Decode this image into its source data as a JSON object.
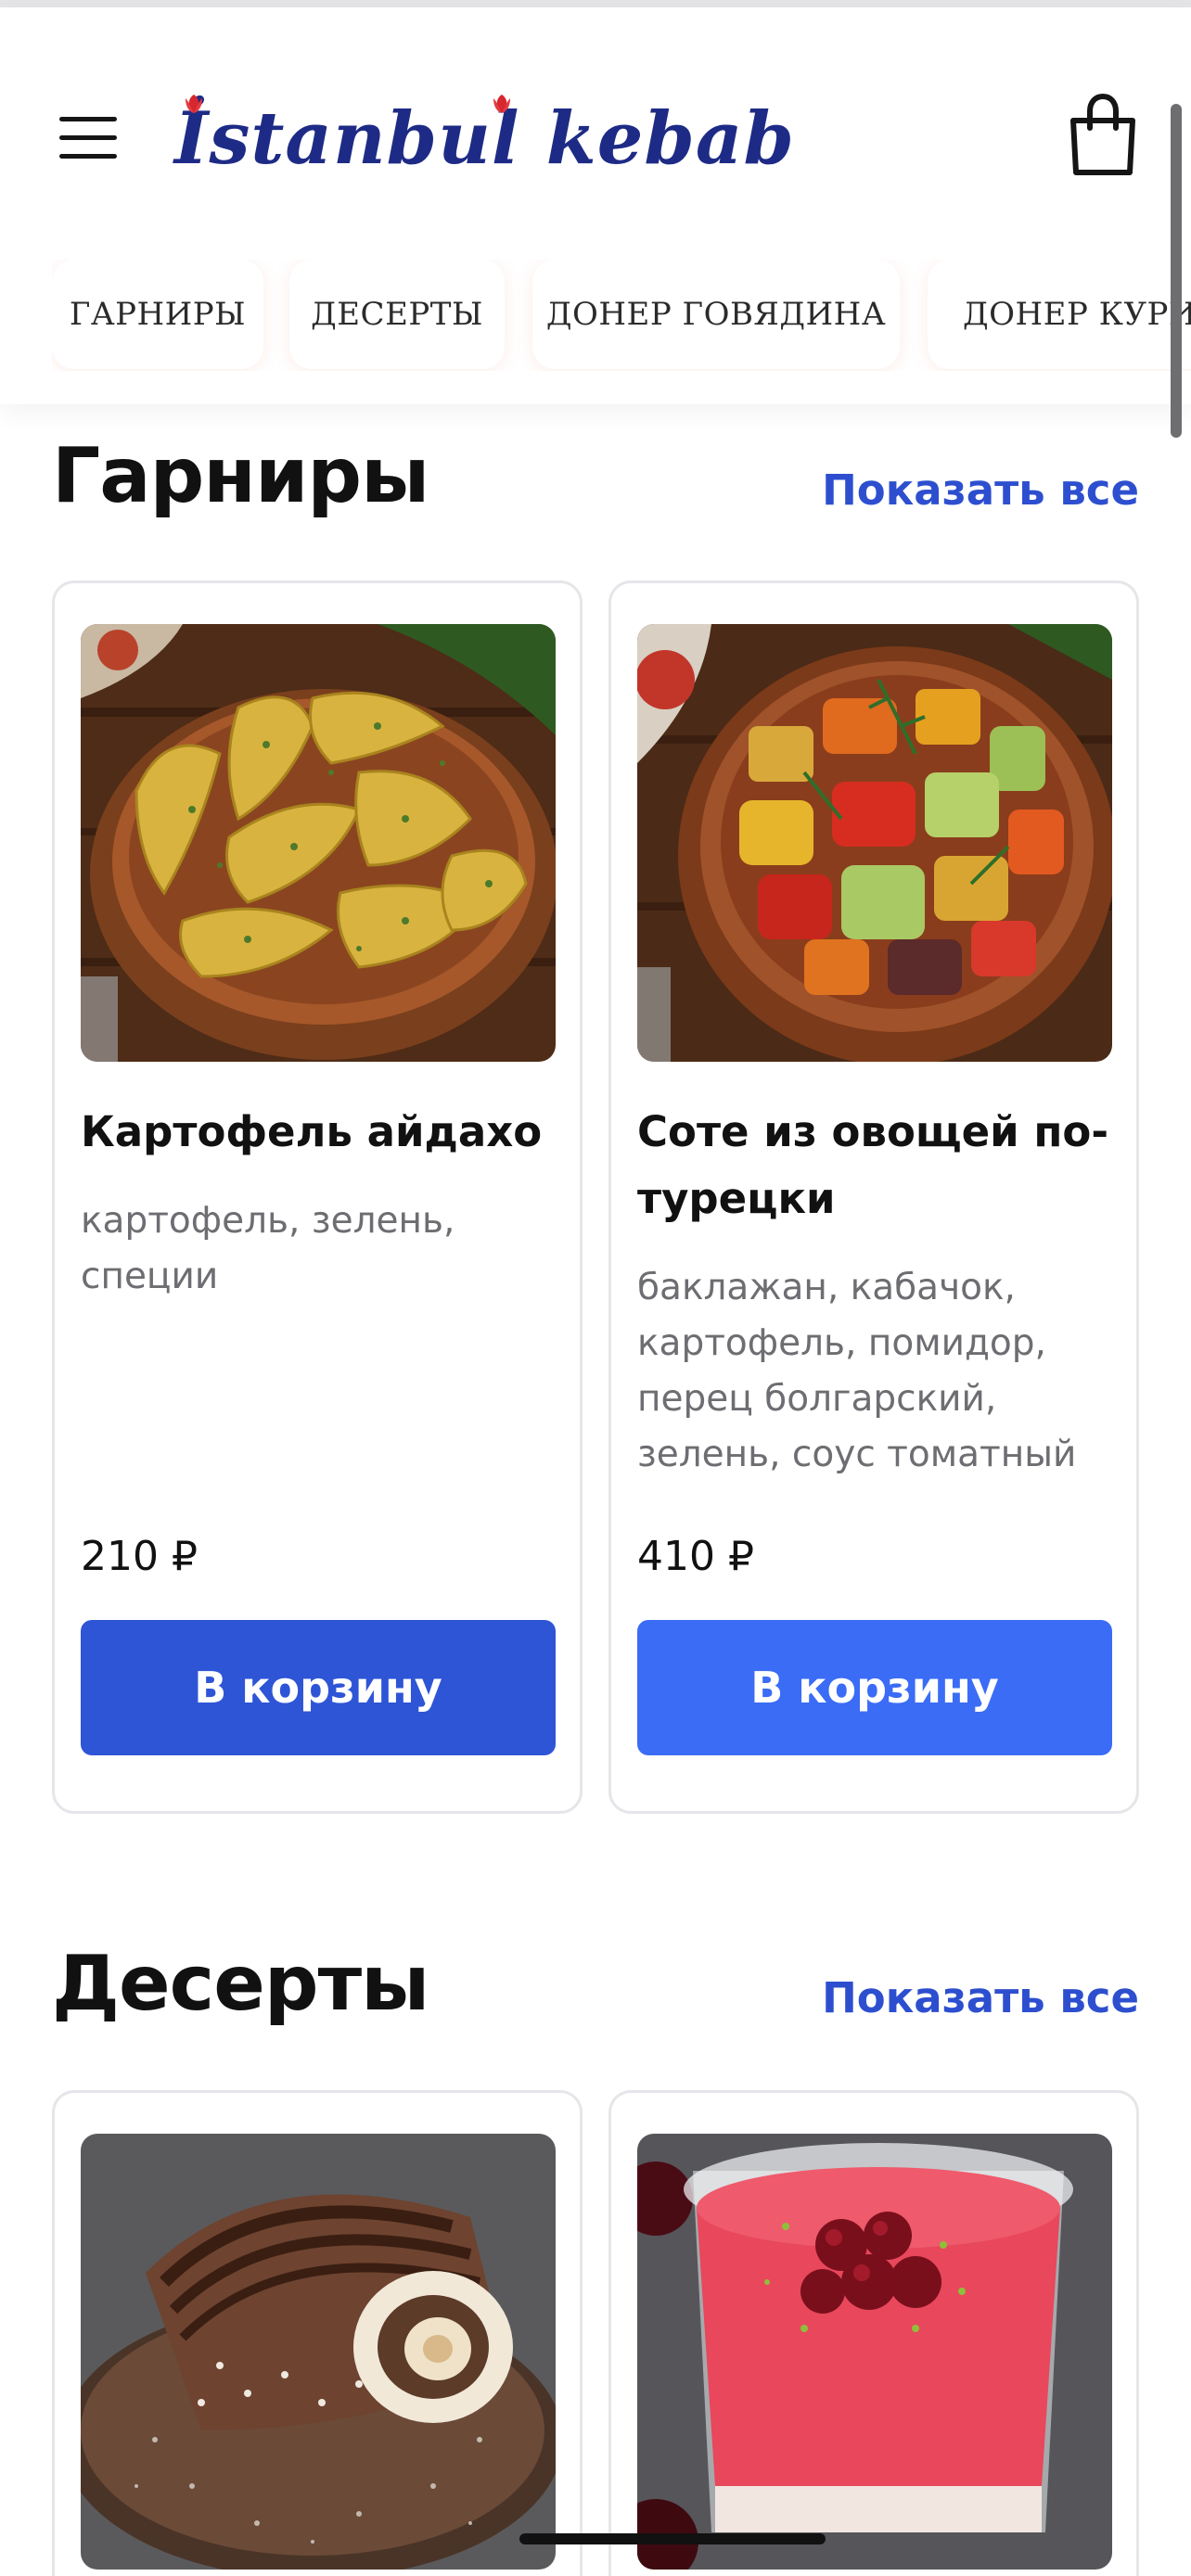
{
  "header": {
    "logo_text": "İstanbul kebab",
    "menu_icon": "hamburger-menu-icon",
    "cart_icon": "shopping-bag-icon",
    "categories": [
      "ГАРНИРЫ",
      "ДЕСЕРТЫ",
      "ДОНЕР ГОВЯДИНА",
      "ДОНЕР КУРИЦА"
    ]
  },
  "sections": [
    {
      "title": "Гарниры",
      "show_all": "Показать все",
      "products": [
        {
          "name": "Картофель айдахо",
          "description": "картофель, зелень, специи",
          "price": "210 ₽",
          "button": "В корзину",
          "button_color": "#2e55d6",
          "image_icon": "potato-wedges-photo"
        },
        {
          "name": "Соте из овощей по-турецки",
          "description": "баклажан, кабачок, картофель, помидор, перец болгарский, зелень, соус томатный",
          "price": "410 ₽",
          "button": "В корзину",
          "button_color": "#3b6cf6",
          "image_icon": "vegetable-saute-photo"
        }
      ]
    },
    {
      "title": "Десерты",
      "show_all": "Показать все",
      "products": [
        {
          "image_icon": "chocolate-roll-cake-photo"
        },
        {
          "image_icon": "cherry-mousse-photo"
        }
      ]
    }
  ],
  "colors": {
    "accent": "#2d4fcf",
    "logo": "#1e2b86",
    "logo_tulip": "#d6262e"
  }
}
